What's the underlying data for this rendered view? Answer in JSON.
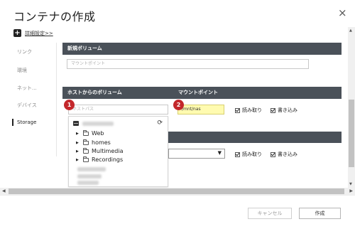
{
  "dialog": {
    "title": "コンテナの作成",
    "close_label": "×"
  },
  "advanced": {
    "icon_label": "+",
    "link_label": "詳細設定>>"
  },
  "nav": {
    "items": [
      {
        "label": "リンク"
      },
      {
        "label": "環境"
      },
      {
        "label": "ネット..."
      },
      {
        "label": "デバイス"
      },
      {
        "label": "Storage"
      }
    ],
    "active": "Storage"
  },
  "new_volume": {
    "header": "新規ボリューム",
    "mount_placeholder": "マウントポイント"
  },
  "host_volume": {
    "header_host": "ホストからのボリューム",
    "header_mount": "マウントポイント",
    "host_path_placeholder": "ホストパス",
    "mount_value": "/mnt/nas",
    "read_label": "読み取り",
    "write_label": "書き込み",
    "read_checked": true,
    "write_checked": true
  },
  "second_row": {
    "read_label": "読み取り",
    "write_label": "書き込み",
    "read_checked": true,
    "write_checked": true
  },
  "badges": [
    "1",
    "2"
  ],
  "folder_dropdown": {
    "refresh_icon": "⟳",
    "folders": [
      {
        "name": "Web"
      },
      {
        "name": "homes"
      },
      {
        "name": "Multimedia"
      },
      {
        "name": "Recordings"
      }
    ]
  },
  "footer": {
    "cancel_label": "キャンセル",
    "create_label": "作成"
  },
  "colors": {
    "header_bg": "#4a5159",
    "badge": "#c3272b",
    "highlight_input": "#fffbb0"
  }
}
